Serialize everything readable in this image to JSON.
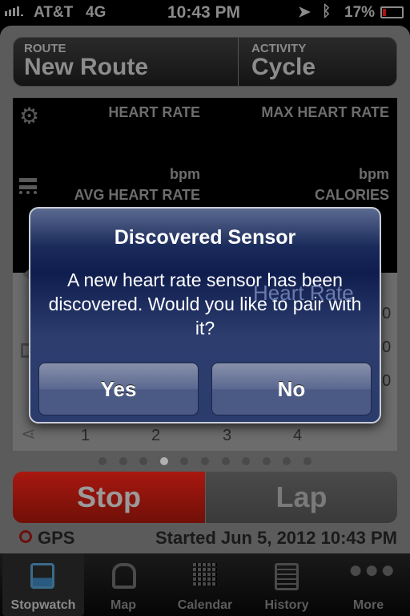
{
  "status": {
    "carrier": "AT&T",
    "network": "4G",
    "time": "10:43 PM",
    "battery": "17%",
    "battery_level": 0.17
  },
  "header": {
    "route_label": "ROUTE",
    "route_value": "New Route",
    "activity_label": "ACTIVITY",
    "activity_value": "Cycle"
  },
  "metrics": {
    "heart_rate": "HEART RATE",
    "max_heart_rate": "MAX HEART RATE",
    "unit": "bpm",
    "avg_heart_rate": "AVG HEART RATE",
    "calories": "CALORIES"
  },
  "chart": {
    "title": "Heart Rate",
    "unit": "bpm",
    "y_ticks": [
      "90",
      "80",
      "70"
    ],
    "x_ticks": [
      "1",
      "2",
      "3",
      "4"
    ]
  },
  "pager": {
    "count": 11,
    "active": 4
  },
  "controls": {
    "stop": "Stop",
    "lap": "Lap",
    "stop_color": "#a81810"
  },
  "footer": {
    "gps": "GPS",
    "started": "Started Jun 5, 2012 10:43 PM"
  },
  "tabs": [
    {
      "label": "Stopwatch",
      "icon": "stopwatch-icon"
    },
    {
      "label": "Map",
      "icon": "map-icon"
    },
    {
      "label": "Calendar",
      "icon": "calendar-icon"
    },
    {
      "label": "History",
      "icon": "history-icon"
    },
    {
      "label": "More",
      "icon": "more-icon"
    }
  ],
  "dialog": {
    "title": "Discovered Sensor",
    "message": "A new heart rate sensor has been discovered. Would you like to pair with it?",
    "yes": "Yes",
    "no": "No"
  }
}
